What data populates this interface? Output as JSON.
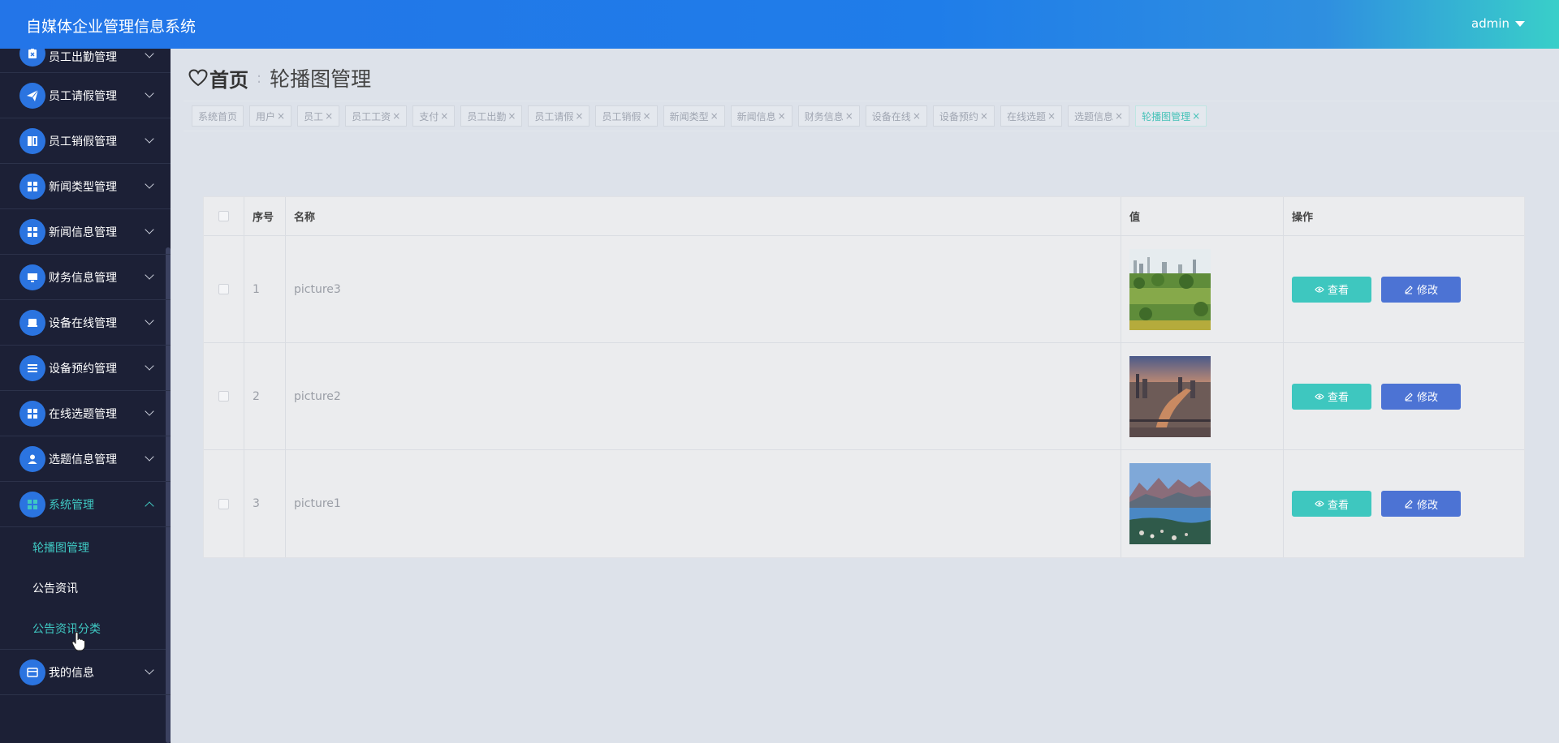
{
  "app": {
    "title": "自媒体企业管理信息系统",
    "user": "admin"
  },
  "sidebar": {
    "items": [
      {
        "label": "员工出勤管理",
        "icon": "clipboard-icon"
      },
      {
        "label": "员工请假管理",
        "icon": "paper-plane-icon"
      },
      {
        "label": "员工销假管理",
        "icon": "book-icon"
      },
      {
        "label": "新闻类型管理",
        "icon": "grid-icon"
      },
      {
        "label": "新闻信息管理",
        "icon": "grid-icon"
      },
      {
        "label": "财务信息管理",
        "icon": "monitor-icon"
      },
      {
        "label": "设备在线管理",
        "icon": "device-icon"
      },
      {
        "label": "设备预约管理",
        "icon": "list-icon"
      },
      {
        "label": "在线选题管理",
        "icon": "grid-icon"
      },
      {
        "label": "选题信息管理",
        "icon": "user-icon"
      },
      {
        "label": "系统管理",
        "icon": "grid-icon"
      },
      {
        "label": "我的信息",
        "icon": "card-icon"
      }
    ],
    "system_sub": [
      {
        "label": "轮播图管理"
      },
      {
        "label": "公告资讯"
      },
      {
        "label": "公告资讯分类"
      }
    ]
  },
  "breadcrumb": {
    "home": "首页",
    "separator": ":",
    "current": "轮播图管理"
  },
  "tags": [
    {
      "label": "系统首页",
      "closable": false
    },
    {
      "label": "用户",
      "closable": true
    },
    {
      "label": "员工",
      "closable": true
    },
    {
      "label": "员工工资",
      "closable": true
    },
    {
      "label": "支付",
      "closable": true
    },
    {
      "label": "员工出勤",
      "closable": true
    },
    {
      "label": "员工请假",
      "closable": true
    },
    {
      "label": "员工销假",
      "closable": true
    },
    {
      "label": "新闻类型",
      "closable": true
    },
    {
      "label": "新闻信息",
      "closable": true
    },
    {
      "label": "财务信息",
      "closable": true
    },
    {
      "label": "设备在线",
      "closable": true
    },
    {
      "label": "设备预约",
      "closable": true
    },
    {
      "label": "在线选题",
      "closable": true
    },
    {
      "label": "选题信息",
      "closable": true
    },
    {
      "label": "轮播图管理",
      "closable": true,
      "active": true
    }
  ],
  "tag_close_glyph": "×",
  "table": {
    "columns": {
      "index": "序号",
      "name": "名称",
      "value": "值",
      "actions": "操作"
    },
    "rows": [
      {
        "index": "1",
        "name": "picture3",
        "image": "city-park-photo"
      },
      {
        "index": "2",
        "name": "picture2",
        "image": "river-city-sunset-photo"
      },
      {
        "index": "3",
        "name": "picture1",
        "image": "mountain-lake-town-photo"
      }
    ],
    "view_label": "查看",
    "edit_label": "修改"
  },
  "colors": {
    "accent": "#3ec7bf",
    "primary": "#4c73d4",
    "header": "#2375e8",
    "sidebar": "#1c2036"
  }
}
